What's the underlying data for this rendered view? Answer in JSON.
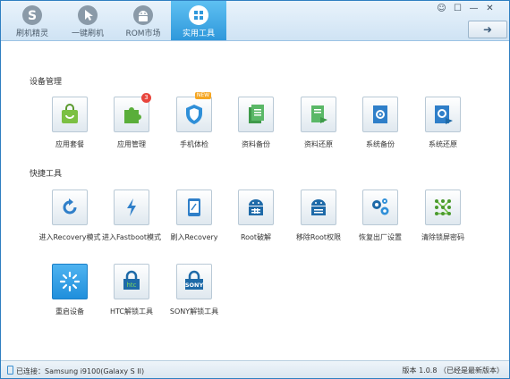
{
  "nav": [
    {
      "label": "刷机精灵",
      "icon": "s-logo-icon",
      "active": false
    },
    {
      "label": "一键刷机",
      "icon": "cursor-icon",
      "active": false
    },
    {
      "label": "ROM市场",
      "icon": "android-icon",
      "active": false
    },
    {
      "label": "实用工具",
      "icon": "grid-icon",
      "active": true
    }
  ],
  "window_controls": {
    "chat": "☺",
    "skin": "☐",
    "min": "—",
    "close": "✕"
  },
  "update_button": {
    "icon": "arrow-down-right-icon"
  },
  "sections": {
    "device_management": {
      "title": "设备管理",
      "items": [
        {
          "label": "应用套餐",
          "icon": "bag-icon"
        },
        {
          "label": "应用管理",
          "icon": "puzzle-icon",
          "badge": "3"
        },
        {
          "label": "手机体检",
          "icon": "shield-icon",
          "tag": "NEW"
        },
        {
          "label": "资料备份",
          "icon": "document-stack-icon"
        },
        {
          "label": "资料还原",
          "icon": "document-restore-icon"
        },
        {
          "label": "系统备份",
          "icon": "system-backup-icon"
        },
        {
          "label": "系统还原",
          "icon": "system-restore-icon"
        }
      ]
    },
    "shortcut_tools": {
      "title": "快捷工具",
      "items": [
        {
          "label": "进入Recovery模式",
          "icon": "refresh-icon"
        },
        {
          "label": "进入Fastboot模式",
          "icon": "lightning-icon"
        },
        {
          "label": "刷入Recovery",
          "icon": "tablet-icon"
        },
        {
          "label": "Root破解",
          "icon": "android-box-icon"
        },
        {
          "label": "移除Root权限",
          "icon": "android-box-icon"
        },
        {
          "label": "恢复出厂设置",
          "icon": "gears-icon"
        },
        {
          "label": "清除锁屏密码",
          "icon": "pattern-lock-icon"
        },
        {
          "label": "重启设备",
          "icon": "spinner-icon"
        },
        {
          "label": "HTC解锁工具",
          "icon": "htc-lock-icon",
          "brand": "htc"
        },
        {
          "label": "SONY解锁工具",
          "icon": "sony-lock-icon",
          "brand": "SONY"
        }
      ]
    }
  },
  "status": {
    "connection": "已连接：Samsung i9100(Galaxy S II)",
    "version": "版本 1.0.8 （已经是最新版本）"
  },
  "colors": {
    "accent": "#2f98db",
    "icon_dark": "#1e6aa8",
    "badge": "#e8453c",
    "new_tag": "#f5a623"
  }
}
